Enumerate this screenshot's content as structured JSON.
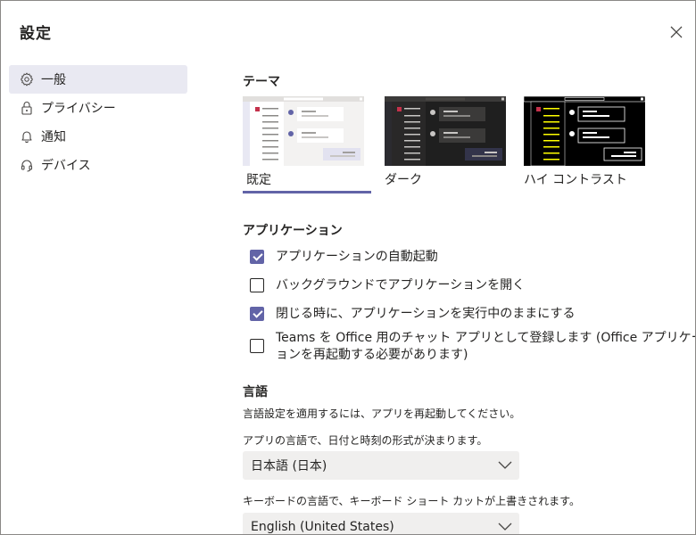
{
  "dialog": {
    "title": "設定"
  },
  "nav": {
    "items": [
      {
        "label": "一般",
        "icon": "gear-icon",
        "active": true
      },
      {
        "label": "プライバシー",
        "icon": "lock-icon",
        "active": false
      },
      {
        "label": "通知",
        "icon": "bell-icon",
        "active": false
      },
      {
        "label": "デバイス",
        "icon": "headset-icon",
        "active": false
      }
    ]
  },
  "theme": {
    "heading": "テーマ",
    "options": [
      {
        "label": "既定",
        "selected": true
      },
      {
        "label": "ダーク",
        "selected": false
      },
      {
        "label": "ハイ コントラスト",
        "selected": false
      }
    ]
  },
  "application": {
    "heading": "アプリケーション",
    "options": [
      {
        "label": "アプリケーションの自動起動",
        "checked": true
      },
      {
        "label": "バックグラウンドでアプリケーションを開く",
        "checked": false
      },
      {
        "label": "閉じる時に、アプリケーションを実行中のままにする",
        "checked": true
      },
      {
        "label_line1": "Teams を Office 用のチャット アプリとして登録します (Office アプリケーシ",
        "label_line2": "ョンを再起動する必要があります)",
        "checked": false
      }
    ]
  },
  "language": {
    "heading": "言語",
    "note": "言語設定を適用するには、アプリを再起動してください。",
    "app_lang_caption": "アプリの言語で、日付と時刻の形式が決まります。",
    "app_lang_value": "日本語 (日本)",
    "keyboard_lang_caption": "キーボードの言語で、キーボード ショート カットが上書きされます。",
    "keyboard_lang_value": "English (United States)"
  },
  "colors": {
    "accent": "#6264a7",
    "active_nav_bg": "#e9e9f2",
    "dropdown_bg": "#f0efee"
  }
}
